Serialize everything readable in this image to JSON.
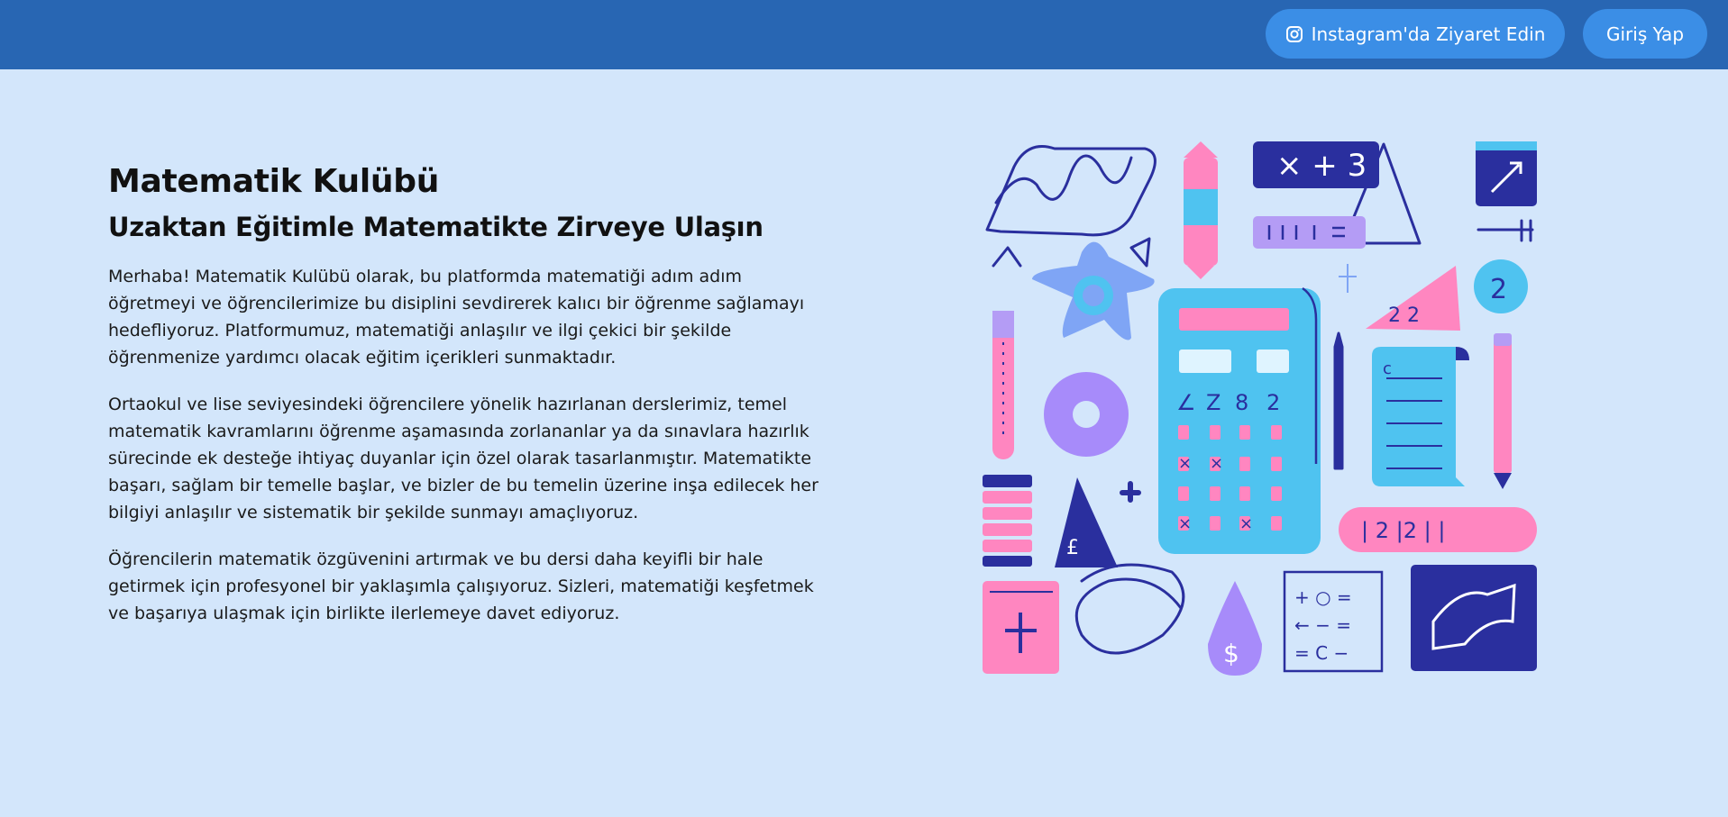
{
  "header": {
    "instagram_label": "Instagram'da Ziyaret Edin",
    "login_label": "Giriş Yap",
    "instagram_icon": "instagram-icon"
  },
  "main": {
    "title": "Matematik Kulübü",
    "subtitle": "Uzaktan Eğitimle Matematikte Zirveye Ulaşın",
    "paragraphs": [
      "Merhaba! Matematik Kulübü olarak, bu platformda matematiği adım adım öğretmeyi ve öğrencilerimize bu disiplini sevdirerek kalıcı bir öğrenme sağlamayı hedefliyoruz. Platformumuz, matematiği anlaşılır ve ilgi çekici bir şekilde öğrenmenize yardımcı olacak eğitim içerikleri sunmaktadır.",
      "Ortaokul ve lise seviyesindeki öğrencilere yönelik hazırlanan derslerimiz, temel matematik kavramlarını öğrenme aşamasında zorlananlar ya da sınavlara hazırlık sürecinde ek desteğe ihtiyaç duyanlar için özel olarak tasarlanmıştır. Matematikte başarı, sağlam bir temelle başlar, ve bizler de bu temelin üzerine inşa edilecek her bilgiyi anlaşılır ve sistematik bir şekilde sunmayı amaçlıyoruz.",
      "Öğrencilerin matematik özgüvenini artırmak ve bu dersi daha keyifli bir hale getirmek için profesyonel bir yaklaşımla çalışıyoruz. Sizleri, matematiği keşfetmek ve başarıya ulaşmak için birlikte ilerlemeye davet ediyoruz."
    ]
  },
  "illustration": {
    "name": "math-illustration",
    "colors": {
      "navy": "#2a2f9e",
      "blue": "#4fc3f0",
      "pink": "#ff86c0",
      "purple": "#a78bfa",
      "lavender": "#b49cf5"
    }
  },
  "colors": {
    "topbar": "#2866b3",
    "button": "#3b8ee6",
    "background": "#d3e6fb"
  }
}
